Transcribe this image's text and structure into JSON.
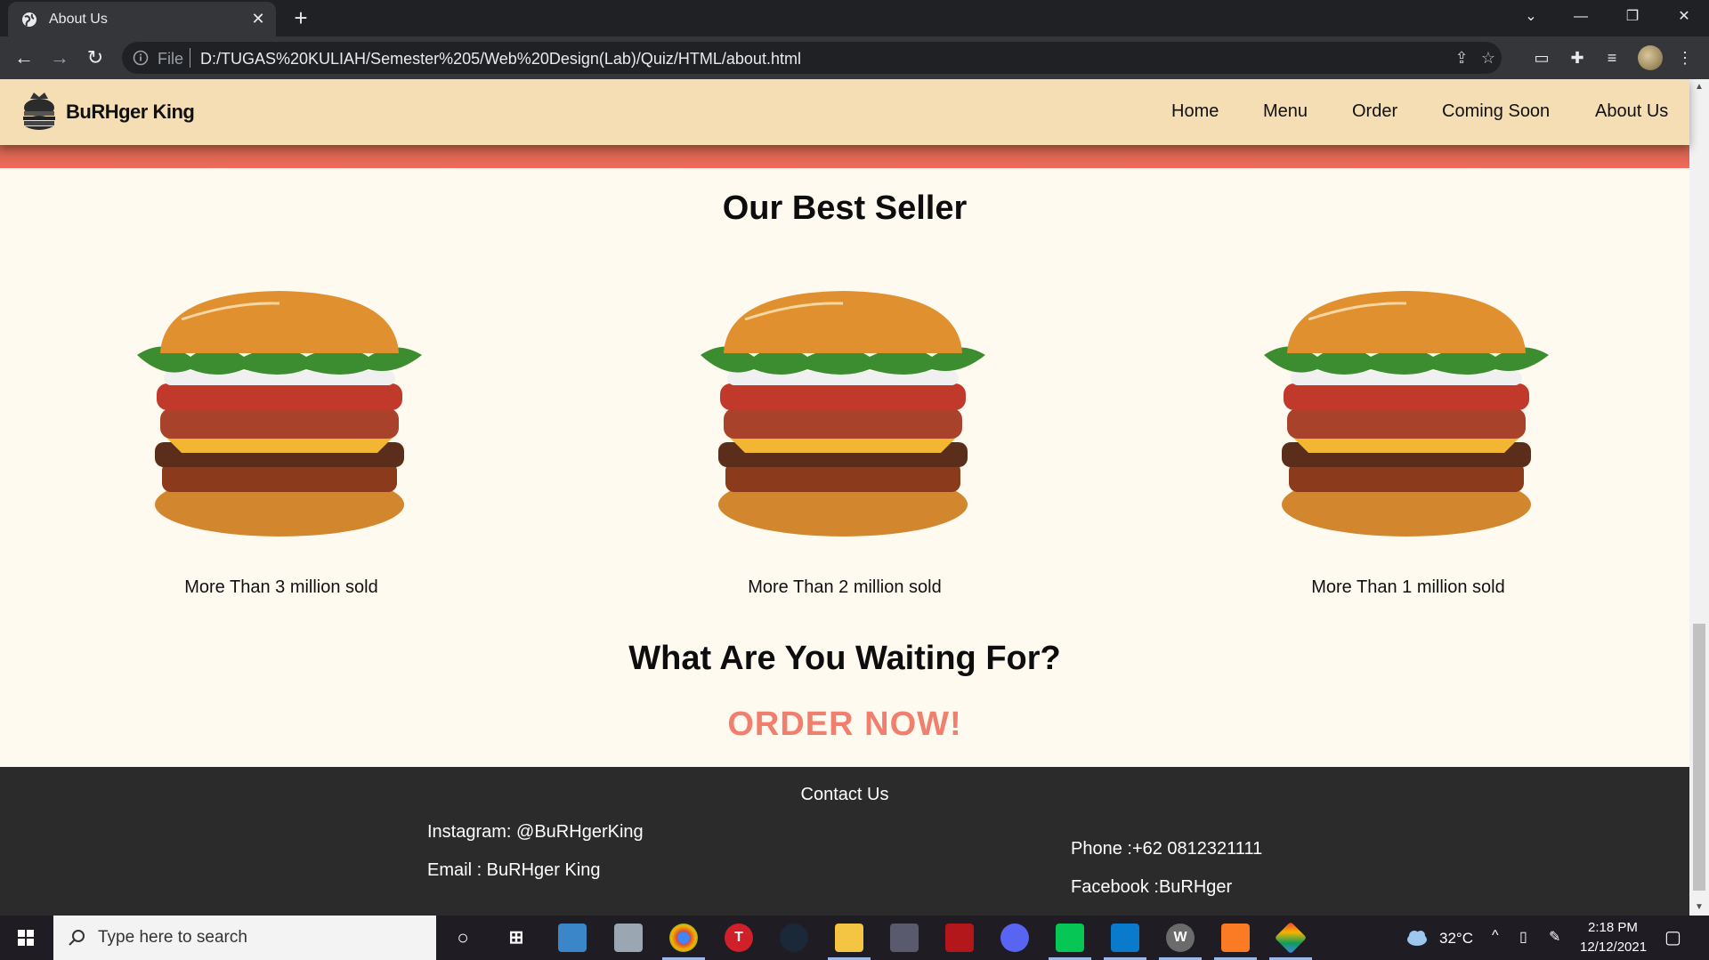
{
  "browser": {
    "tab_title": "About Us",
    "tab_close": "✕",
    "new_tab": "+",
    "window_controls": {
      "tab_search": "⌄",
      "minimize": "—",
      "restore": "❐",
      "close": "✕"
    },
    "omnibox": {
      "scheme_label": "File",
      "url": "D:/TUGAS%20KULIAH/Semester%205/Web%20Design(Lab)/Quiz/HTML/about.html"
    },
    "icons": [
      "back-icon",
      "forward-icon",
      "reload-icon",
      "info-icon",
      "share-icon",
      "star-icon",
      "cast-icon",
      "extensions-icon",
      "reading-list-icon",
      "profile-avatar",
      "menu-icon"
    ]
  },
  "site": {
    "brand": "BuRHger King",
    "nav": [
      "Home",
      "Menu",
      "Order",
      "Coming Soon",
      "About Us"
    ],
    "best_seller_title": "Our Best Seller",
    "products": [
      {
        "caption": "More Than 3 million sold"
      },
      {
        "caption": "More Than 2 million sold"
      },
      {
        "caption": "More Than 1 million sold"
      }
    ],
    "cta_title": "What Are You Waiting For?",
    "cta_link": "ORDER NOW!",
    "colors": {
      "header_bg": "#f5deb3",
      "page_bg": "#fffaf0",
      "accent": "#f07f6e",
      "footer_bg": "#2b2b2b"
    }
  },
  "footer": {
    "title": "Contact Us",
    "instagram": "Instagram: @BuRHgerKing",
    "email": "Email : BuRHger King",
    "phone": "Phone :+62 0812321111",
    "facebook": "Facebook :BuRHger"
  },
  "taskbar": {
    "search_placeholder": "Type here to search",
    "temperature": "32°C",
    "time": "2:18 PM",
    "date": "12/12/2021",
    "apps": [
      "cortana-icon",
      "task-view-icon",
      "control-panel-icon",
      "file-manager-icon",
      "chrome-icon",
      "t-app-icon",
      "steam-icon",
      "file-explorer-icon",
      "app-icon",
      "app-red-icon",
      "discord-icon",
      "line-icon",
      "vscode-icon",
      "wakatime-icon",
      "xampp-icon",
      "git-icon"
    ]
  }
}
